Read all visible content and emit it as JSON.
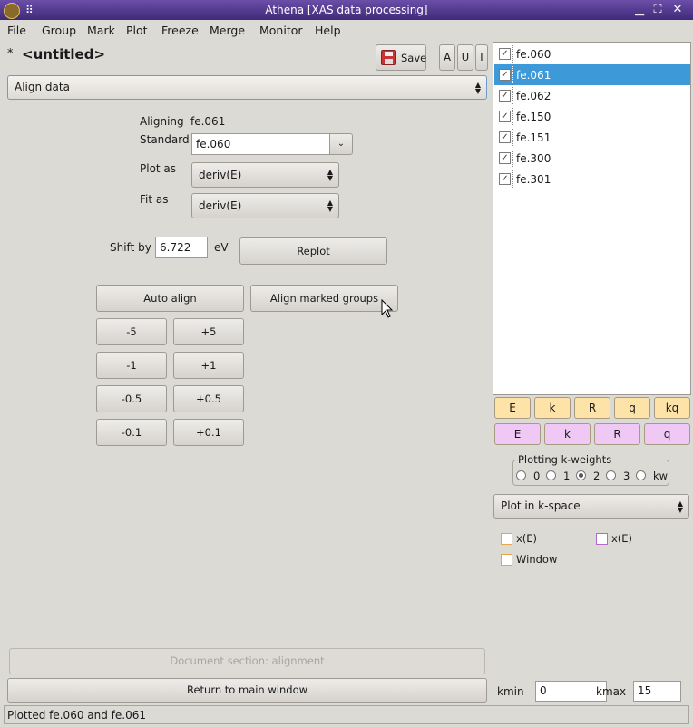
{
  "window": {
    "title": "Athena [XAS data processing]"
  },
  "menu": [
    "File",
    "Group",
    "Mark",
    "Plot",
    "Freeze",
    "Merge",
    "Monitor",
    "Help"
  ],
  "header": {
    "modified_marker": "*",
    "project_name": "<untitled>",
    "save_label": "Save",
    "btn_a": "A",
    "btn_u": "U",
    "btn_i": "I"
  },
  "tool_select": "Align data",
  "align": {
    "aligning_label": "Aligning",
    "aligning_value": "fe.061",
    "standard_label": "Standard",
    "standard_value": "fe.060",
    "plot_as_label": "Plot as",
    "plot_as_value": "deriv(E)",
    "fit_as_label": "Fit as",
    "fit_as_value": "deriv(E)",
    "shift_label": "Shift by",
    "shift_value": "6.722",
    "shift_unit": "eV",
    "replot_label": "Replot",
    "auto_align_label": "Auto align",
    "align_marked_label": "Align marked groups",
    "steps": [
      "-5",
      "+5",
      "-1",
      "+1",
      "-0.5",
      "+0.5",
      "-0.1",
      "+0.1"
    ]
  },
  "doc_label": "Document section: alignment",
  "return_label": "Return to main window",
  "status": "Plotted fe.060 and fe.061",
  "groups": [
    {
      "name": "fe.060",
      "checked": true,
      "selected": false
    },
    {
      "name": "fe.061",
      "checked": true,
      "selected": true
    },
    {
      "name": "fe.062",
      "checked": true,
      "selected": false
    },
    {
      "name": "fe.150",
      "checked": true,
      "selected": false
    },
    {
      "name": "fe.151",
      "checked": true,
      "selected": false
    },
    {
      "name": "fe.300",
      "checked": true,
      "selected": false
    },
    {
      "name": "fe.301",
      "checked": true,
      "selected": false
    }
  ],
  "plot_buttons_single": [
    "E",
    "k",
    "R",
    "q",
    "kq"
  ],
  "plot_buttons_marked": [
    "E",
    "k",
    "R",
    "q"
  ],
  "colors": {
    "single": "#fde3a7",
    "marked": "#f0c8f5",
    "selection": "#3d99d8"
  },
  "kweights": {
    "label": "Plotting k-weights",
    "options": [
      "0",
      "1",
      "2",
      "3",
      "kw"
    ],
    "selected": "2"
  },
  "plot_space": "Plot in k-space",
  "options": {
    "xe_single": "x(E)",
    "xe_marked": "x(E)",
    "window": "Window"
  },
  "kmin_label": "kmin",
  "kmin_value": "0",
  "kmax_label": "kmax",
  "kmax_value": "15"
}
